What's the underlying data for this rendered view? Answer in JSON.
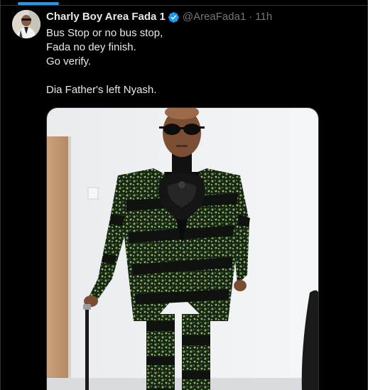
{
  "post": {
    "display_name": "Charly Boy Area Fada 1",
    "handle": "@AreaFada1",
    "separator": "·",
    "timestamp": "11h",
    "lines": [
      "Bus Stop or no bus stop,",
      "Fada no dey finish.",
      "Go verify.",
      "",
      "Dia Father's left Nyash."
    ]
  },
  "icons": {
    "verified": "verified-badge-icon"
  },
  "colors": {
    "background": "#000000",
    "accent": "#1d9bf0",
    "text": "#e7e9ea",
    "muted": "#71767b",
    "border": "#2f3336"
  }
}
